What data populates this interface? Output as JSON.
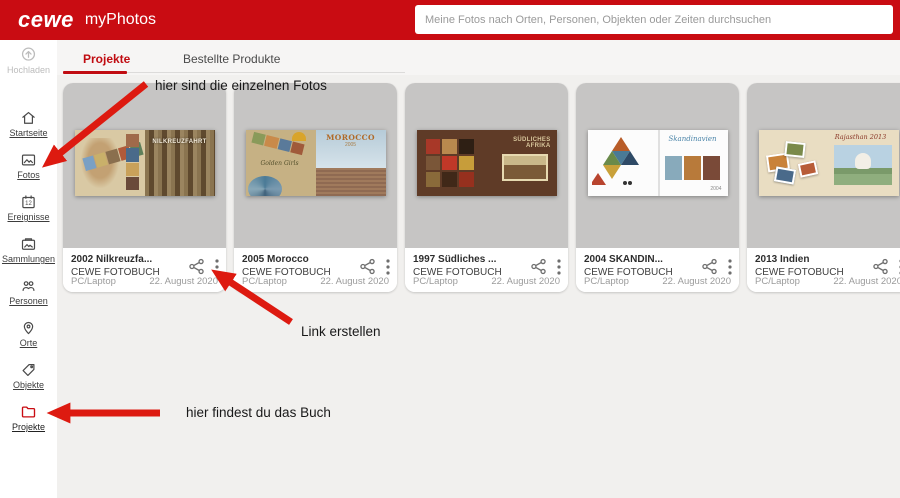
{
  "header": {
    "logo": "cewe",
    "app_name": "myPhotos",
    "search_placeholder": "Meine Fotos nach Orten, Personen, Objekten oder Zeiten durchsuchen"
  },
  "sidebar": {
    "calendar_day": "12",
    "items": [
      {
        "label": "Hochladen"
      },
      {
        "label": "Startseite"
      },
      {
        "label": "Fotos"
      },
      {
        "label": "Ereignisse"
      },
      {
        "label": "Sammlungen"
      },
      {
        "label": "Personen"
      },
      {
        "label": "Orte"
      },
      {
        "label": "Objekte"
      },
      {
        "label": "Projekte"
      }
    ]
  },
  "tabs": {
    "projekte": "Projekte",
    "bestellte": "Bestellte Produkte"
  },
  "cards": [
    {
      "title": "2002 Nilkreuzfa...",
      "product": "CEWE FOTOBUCH",
      "source": "PC/Laptop",
      "date": "22. August 2020",
      "cover": {
        "title": "NILKREUZFAHRT"
      }
    },
    {
      "title": "2005 Morocco",
      "product": "CEWE FOTOBUCH",
      "source": "PC/Laptop",
      "date": "22. August 2020",
      "cover": {
        "left_text": "Golden Girls",
        "title": "MOROCCO",
        "year": "2005"
      }
    },
    {
      "title": "1997 Südliches ...",
      "product": "CEWE FOTOBUCH",
      "source": "PC/Laptop",
      "date": "22. August 2020",
      "cover": {
        "title": "SÜDLICHES AFRIKA"
      }
    },
    {
      "title": "2004 SKANDIN...",
      "product": "CEWE FOTOBUCH",
      "source": "PC/Laptop",
      "date": "22. August 2020",
      "cover": {
        "title": "Skandinavien",
        "year": "2004"
      }
    },
    {
      "title": "2013 Indien",
      "product": "CEWE FOTOBUCH",
      "source": "PC/Laptop",
      "date": "22. August 2020",
      "cover": {
        "title": "Rajasthan  2013"
      }
    }
  ],
  "annotations": {
    "photos_note": "hier sind die einzelnen Fotos",
    "link_note": "Link erstellen",
    "book_note": "hier findest du das Buch"
  },
  "colors": {
    "brand_red": "#c90c12",
    "active_tab_red": "#c00c11",
    "arrow_red": "#dd1a10",
    "thumb_gray": "#c6c5c4",
    "content_bg": "#f1f0ee"
  }
}
